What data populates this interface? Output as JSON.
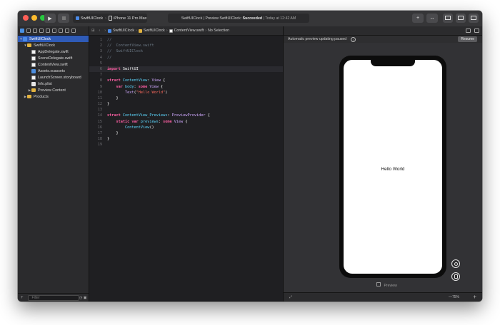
{
  "toolbar": {
    "scheme_target": "SwiftUIClock",
    "scheme_device": "iPhone 11 Pro Max",
    "status_prefix": "SwiftUIClock | Preview SwiftUIClock:",
    "status_result": "Succeeded",
    "status_time": "| Today at 12:42 AM",
    "library_label": "+",
    "review_label": "↔"
  },
  "navigator": {
    "items": [
      {
        "label": "SwiftUIClock",
        "disclosure": "▼",
        "icon": "project-icon"
      },
      {
        "label": "SwiftUIClock",
        "disclosure": "▼",
        "icon": "folder-icon"
      },
      {
        "label": "AppDelegate.swift",
        "disclosure": "",
        "icon": "swift-file-icon"
      },
      {
        "label": "SceneDelegate.swift",
        "disclosure": "",
        "icon": "swift-file-icon"
      },
      {
        "label": "ContentView.swift",
        "disclosure": "",
        "icon": "swift-file-icon"
      },
      {
        "label": "Assets.xcassets",
        "disclosure": "",
        "icon": "asset-catalog-icon"
      },
      {
        "label": "LaunchScreen.storyboard",
        "disclosure": "",
        "icon": "storyboard-icon"
      },
      {
        "label": "Info.plist",
        "disclosure": "",
        "icon": "plist-icon"
      },
      {
        "label": "Preview Content",
        "disclosure": "▶",
        "icon": "folder-icon"
      },
      {
        "label": "Products",
        "disclosure": "▶",
        "icon": "folder-icon"
      }
    ],
    "filter_placeholder": "Filter",
    "add_label": "+"
  },
  "editor": {
    "breadcrumb": [
      "SwiftUIClock",
      "SwiftUIClock",
      "ContentView.swift",
      "No Selection"
    ],
    "lines": [
      {
        "n": "1",
        "tokens": [
          {
            "t": "//",
            "c": "comment"
          }
        ]
      },
      {
        "n": "2",
        "tokens": [
          {
            "t": "//  ContentView.swift",
            "c": "comment"
          }
        ]
      },
      {
        "n": "3",
        "tokens": [
          {
            "t": "//  SwiftUIClock",
            "c": "comment"
          }
        ]
      },
      {
        "n": "4",
        "tokens": [
          {
            "t": "//",
            "c": "comment"
          }
        ]
      },
      {
        "n": "5",
        "tokens": []
      },
      {
        "n": "6",
        "tokens": [
          {
            "t": "import",
            "c": "keyword"
          },
          {
            "t": " SwiftUI",
            "c": "plain"
          }
        ]
      },
      {
        "n": "7",
        "tokens": []
      },
      {
        "n": "8",
        "tokens": [
          {
            "t": "struct",
            "c": "keyword"
          },
          {
            "t": " ContentView",
            "c": "type"
          },
          {
            "t": ": ",
            "c": "plain"
          },
          {
            "t": "View",
            "c": "other"
          },
          {
            "t": " {",
            "c": "plain"
          }
        ]
      },
      {
        "n": "9",
        "tokens": [
          {
            "t": "    ",
            "c": "plain"
          },
          {
            "t": "var",
            "c": "keyword"
          },
          {
            "t": " body",
            "c": "type"
          },
          {
            "t": ": ",
            "c": "plain"
          },
          {
            "t": "some",
            "c": "keyword"
          },
          {
            "t": " View",
            "c": "other"
          },
          {
            "t": " {",
            "c": "plain"
          }
        ]
      },
      {
        "n": "10",
        "tokens": [
          {
            "t": "        ",
            "c": "plain"
          },
          {
            "t": "Text",
            "c": "other"
          },
          {
            "t": "(",
            "c": "plain"
          },
          {
            "t": "\"Hello World\"",
            "c": "string"
          },
          {
            "t": ")",
            "c": "plain"
          }
        ]
      },
      {
        "n": "11",
        "tokens": [
          {
            "t": "    }",
            "c": "plain"
          }
        ]
      },
      {
        "n": "12",
        "tokens": [
          {
            "t": "}",
            "c": "plain"
          }
        ]
      },
      {
        "n": "13",
        "tokens": []
      },
      {
        "n": "14",
        "tokens": [
          {
            "t": "struct",
            "c": "keyword"
          },
          {
            "t": " ContentView_Previews",
            "c": "type"
          },
          {
            "t": ": ",
            "c": "plain"
          },
          {
            "t": "PreviewProvider",
            "c": "other"
          },
          {
            "t": " {",
            "c": "plain"
          }
        ]
      },
      {
        "n": "15",
        "tokens": [
          {
            "t": "    ",
            "c": "plain"
          },
          {
            "t": "static",
            "c": "keyword"
          },
          {
            "t": " ",
            "c": "plain"
          },
          {
            "t": "var",
            "c": "keyword"
          },
          {
            "t": " previews",
            "c": "type"
          },
          {
            "t": ": ",
            "c": "plain"
          },
          {
            "t": "some",
            "c": "keyword"
          },
          {
            "t": " View",
            "c": "other"
          },
          {
            "t": " {",
            "c": "plain"
          }
        ]
      },
      {
        "n": "16",
        "tokens": [
          {
            "t": "        ",
            "c": "plain"
          },
          {
            "t": "ContentView",
            "c": "type"
          },
          {
            "t": "()",
            "c": "plain"
          }
        ]
      },
      {
        "n": "17",
        "tokens": [
          {
            "t": "    }",
            "c": "plain"
          }
        ]
      },
      {
        "n": "18",
        "tokens": [
          {
            "t": "}",
            "c": "plain"
          }
        ]
      },
      {
        "n": "19",
        "tokens": []
      }
    ]
  },
  "canvas": {
    "banner": "Automatic preview updating paused",
    "resume_label": "Resume",
    "device_text": "Hello World",
    "preview_label": "Preview",
    "zoom_level": "—75%",
    "zoom_in": "+"
  },
  "colors": {
    "accent": "#2f5bb7",
    "keyword": "#fc5fa3",
    "type": "#5dd8ff",
    "string": "#fc6a5d",
    "comment": "#6c7986"
  }
}
